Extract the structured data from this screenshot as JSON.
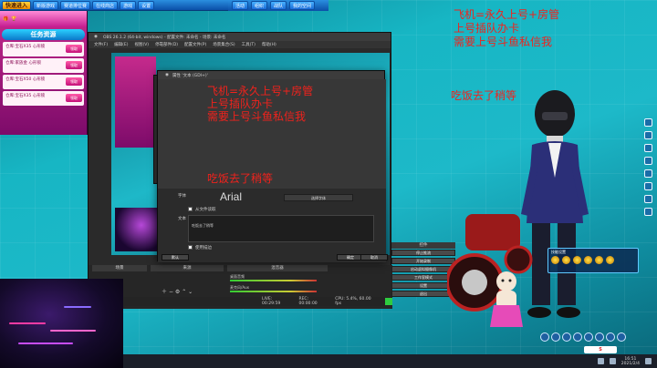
{
  "game": {
    "top_buttons": [
      "快速进入",
      "新版游戏",
      "赛道排位赛",
      "在线商店",
      "游戏",
      "设置",
      "活动",
      "组织",
      "战队",
      "我的空间"
    ],
    "left_panel": {
      "tab_label": "任务资源",
      "rows": [
        {
          "text": "仓库:宝石X35 心形锁",
          "button": "领取"
        },
        {
          "text": "仓库:家族金 心形锁",
          "button": "领取"
        },
        {
          "text": "仓库:宝石X50 心形锁",
          "button": "领取"
        },
        {
          "text": "仓库:宝石X35 心形锁",
          "button": "领取"
        }
      ]
    },
    "skill_panel": {
      "title": "技能设置"
    },
    "brand_badge": "S",
    "clock": {
      "time": "16:51",
      "date": "2021/2/4"
    }
  },
  "obs": {
    "title": "OBS 26.1.2 (64-bit, windows) - 配置文件: 未命名 - 场景: 未命名",
    "menu": [
      "文件(F)",
      "编辑(E)",
      "视图(V)",
      "停靠部件(D)",
      "配置文件(P)",
      "场景集合(S)",
      "工具(T)",
      "帮助(H)"
    ],
    "docks": {
      "scenes": "场景",
      "sources": "来源",
      "mixer": "混音器",
      "transitions": "转场特效",
      "controls": "控件"
    },
    "controls": [
      "停止推流",
      "开始录制",
      "启动虚拟摄像机",
      "工作室模式",
      "设置",
      "退出"
    ],
    "status": {
      "live": "LIVE: 00:29:59",
      "rec": "REC: 00:00:00",
      "cpu": "CPU: 5.4%, 60.00 fps"
    },
    "audio": {
      "desktop": "桌面音频",
      "mic": "麦克风/Aux"
    }
  },
  "dialog": {
    "title": "属性 '文本 (GDI+)'",
    "preview_lines": [
      "飞机=永久上号+房管",
      "上号插队办卡",
      "需要上号斗鱼私信我"
    ],
    "preview_footer": "吃饭去了稍等",
    "font_label": "字体",
    "font_name": "Arial",
    "select_font_label": "选择字体",
    "from_file_label": "从文件读取",
    "text_label": "文本",
    "text_value": "吃饭去了稍等",
    "outline_label": "使用描边",
    "defaults_button": "默认",
    "ok_button": "确定",
    "cancel_button": "取消"
  },
  "overlay": {
    "top_right_lines": [
      "飞机=永久上号+房管",
      "上号插队办卡",
      "需要上号斗鱼私信我"
    ],
    "right_mid": "吃饭去了稍等"
  },
  "colors": {
    "overlay_text": "#f0221c",
    "scene_teal": "#1db9c9",
    "obs_bg": "#2a2a2a"
  }
}
